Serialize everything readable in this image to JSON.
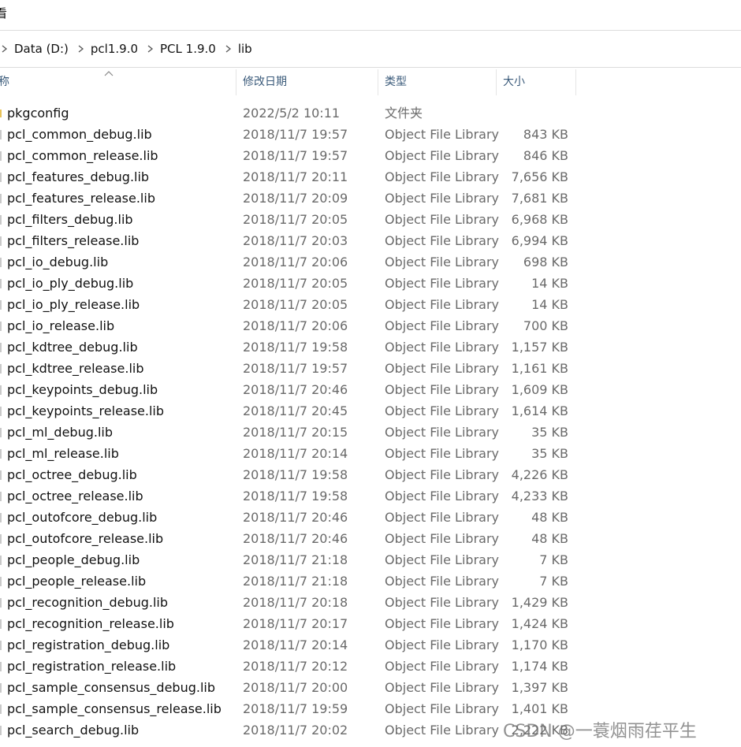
{
  "menu": {
    "label": "看"
  },
  "breadcrumb": [
    {
      "label": "Data (D:)"
    },
    {
      "label": "pcl1.9.0"
    },
    {
      "label": "PCL 1.9.0"
    },
    {
      "label": "lib"
    }
  ],
  "columns": {
    "name": "称",
    "date": "修改日期",
    "type": "类型",
    "size": "大小"
  },
  "colors": {
    "header_text": "#3a5a7a",
    "secondary_text": "#6a6a6a",
    "folder_icon": "#e8c35a"
  },
  "files": [
    {
      "name": "pkgconfig",
      "date": "2022/5/2 10:11",
      "type": "文件夹",
      "size": "",
      "icon": "folder-icon"
    },
    {
      "name": "pcl_common_debug.lib",
      "date": "2018/11/7 19:57",
      "type": "Object File Library",
      "size": "843 KB",
      "icon": "file-icon"
    },
    {
      "name": "pcl_common_release.lib",
      "date": "2018/11/7 19:57",
      "type": "Object File Library",
      "size": "846 KB",
      "icon": "file-icon"
    },
    {
      "name": "pcl_features_debug.lib",
      "date": "2018/11/7 20:11",
      "type": "Object File Library",
      "size": "7,656 KB",
      "icon": "file-icon"
    },
    {
      "name": "pcl_features_release.lib",
      "date": "2018/11/7 20:09",
      "type": "Object File Library",
      "size": "7,681 KB",
      "icon": "file-icon"
    },
    {
      "name": "pcl_filters_debug.lib",
      "date": "2018/11/7 20:05",
      "type": "Object File Library",
      "size": "6,968 KB",
      "icon": "file-icon"
    },
    {
      "name": "pcl_filters_release.lib",
      "date": "2018/11/7 20:03",
      "type": "Object File Library",
      "size": "6,994 KB",
      "icon": "file-icon"
    },
    {
      "name": "pcl_io_debug.lib",
      "date": "2018/11/7 20:06",
      "type": "Object File Library",
      "size": "698 KB",
      "icon": "file-icon"
    },
    {
      "name": "pcl_io_ply_debug.lib",
      "date": "2018/11/7 20:05",
      "type": "Object File Library",
      "size": "14 KB",
      "icon": "file-icon"
    },
    {
      "name": "pcl_io_ply_release.lib",
      "date": "2018/11/7 20:05",
      "type": "Object File Library",
      "size": "14 KB",
      "icon": "file-icon"
    },
    {
      "name": "pcl_io_release.lib",
      "date": "2018/11/7 20:06",
      "type": "Object File Library",
      "size": "700 KB",
      "icon": "file-icon"
    },
    {
      "name": "pcl_kdtree_debug.lib",
      "date": "2018/11/7 19:58",
      "type": "Object File Library",
      "size": "1,157 KB",
      "icon": "file-icon"
    },
    {
      "name": "pcl_kdtree_release.lib",
      "date": "2018/11/7 19:57",
      "type": "Object File Library",
      "size": "1,161 KB",
      "icon": "file-icon"
    },
    {
      "name": "pcl_keypoints_debug.lib",
      "date": "2018/11/7 20:46",
      "type": "Object File Library",
      "size": "1,609 KB",
      "icon": "file-icon"
    },
    {
      "name": "pcl_keypoints_release.lib",
      "date": "2018/11/7 20:45",
      "type": "Object File Library",
      "size": "1,614 KB",
      "icon": "file-icon"
    },
    {
      "name": "pcl_ml_debug.lib",
      "date": "2018/11/7 20:15",
      "type": "Object File Library",
      "size": "35 KB",
      "icon": "file-icon"
    },
    {
      "name": "pcl_ml_release.lib",
      "date": "2018/11/7 20:14",
      "type": "Object File Library",
      "size": "35 KB",
      "icon": "file-icon"
    },
    {
      "name": "pcl_octree_debug.lib",
      "date": "2018/11/7 19:58",
      "type": "Object File Library",
      "size": "4,226 KB",
      "icon": "file-icon"
    },
    {
      "name": "pcl_octree_release.lib",
      "date": "2018/11/7 19:58",
      "type": "Object File Library",
      "size": "4,233 KB",
      "icon": "file-icon"
    },
    {
      "name": "pcl_outofcore_debug.lib",
      "date": "2018/11/7 20:46",
      "type": "Object File Library",
      "size": "48 KB",
      "icon": "file-icon"
    },
    {
      "name": "pcl_outofcore_release.lib",
      "date": "2018/11/7 20:46",
      "type": "Object File Library",
      "size": "48 KB",
      "icon": "file-icon"
    },
    {
      "name": "pcl_people_debug.lib",
      "date": "2018/11/7 21:18",
      "type": "Object File Library",
      "size": "7 KB",
      "icon": "file-icon"
    },
    {
      "name": "pcl_people_release.lib",
      "date": "2018/11/7 21:18",
      "type": "Object File Library",
      "size": "7 KB",
      "icon": "file-icon"
    },
    {
      "name": "pcl_recognition_debug.lib",
      "date": "2018/11/7 20:18",
      "type": "Object File Library",
      "size": "1,429 KB",
      "icon": "file-icon"
    },
    {
      "name": "pcl_recognition_release.lib",
      "date": "2018/11/7 20:17",
      "type": "Object File Library",
      "size": "1,424 KB",
      "icon": "file-icon"
    },
    {
      "name": "pcl_registration_debug.lib",
      "date": "2018/11/7 20:14",
      "type": "Object File Library",
      "size": "1,170 KB",
      "icon": "file-icon"
    },
    {
      "name": "pcl_registration_release.lib",
      "date": "2018/11/7 20:12",
      "type": "Object File Library",
      "size": "1,174 KB",
      "icon": "file-icon"
    },
    {
      "name": "pcl_sample_consensus_debug.lib",
      "date": "2018/11/7 20:00",
      "type": "Object File Library",
      "size": "1,397 KB",
      "icon": "file-icon"
    },
    {
      "name": "pcl_sample_consensus_release.lib",
      "date": "2018/11/7 19:59",
      "type": "Object File Library",
      "size": "1,401 KB",
      "icon": "file-icon"
    },
    {
      "name": "pcl_search_debug.lib",
      "date": "2018/11/7 20:02",
      "type": "Object File Library",
      "size": "2,222 KB",
      "icon": "file-icon"
    }
  ],
  "watermark": "CSDN @一蓑烟雨荏平生"
}
